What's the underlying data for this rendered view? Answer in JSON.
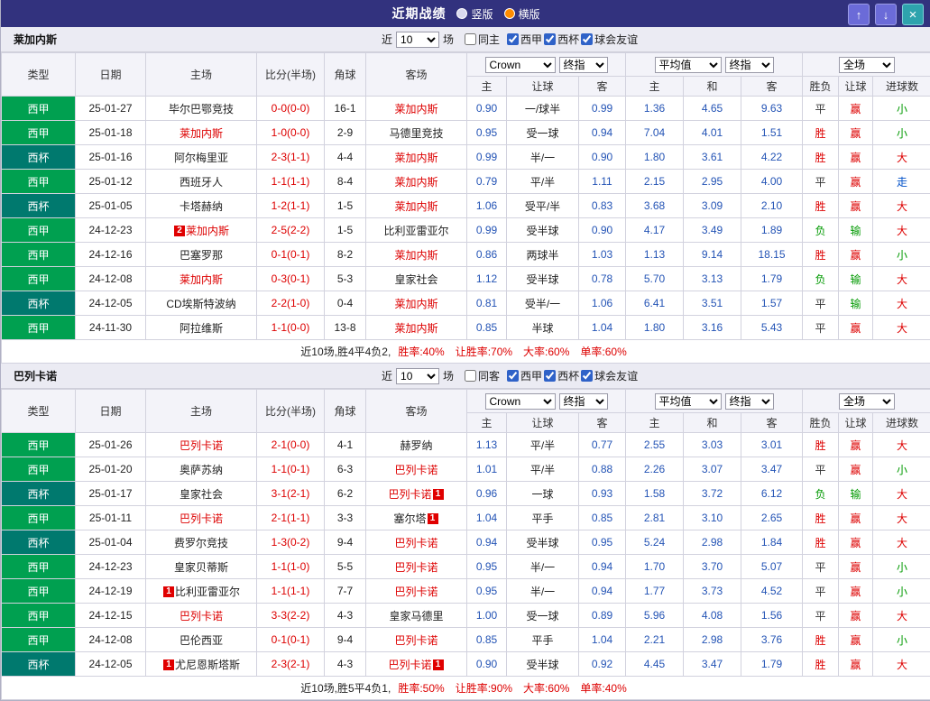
{
  "topbar": {
    "title": "近期战绩",
    "radios": {
      "vertical": "竖版",
      "horizontal": "横版",
      "selected": "横版"
    },
    "buttons": {
      "up": "↑",
      "down": "↓",
      "close": "×"
    }
  },
  "dropdowns": {
    "bookmaker": "Crown",
    "ah_stage": "终指",
    "eu_average": "平均值",
    "eu_stage": "终指",
    "scope": "全场"
  },
  "header_labels": {
    "type": "类型",
    "date": "日期",
    "home": "主场",
    "score": "比分(半场)",
    "corner": "角球",
    "away": "客场",
    "ah_home": "主",
    "ah_line": "让球",
    "ah_away": "客",
    "eu_home": "主",
    "eu_draw": "和",
    "eu_away": "客",
    "result": "胜负",
    "ah_result": "让球",
    "goals": "进球数"
  },
  "colors": {
    "topbar_bg": "#32327E",
    "radio_selected": "#FF8C00",
    "button_blue": "#6B6BD8",
    "button_teal": "#2EA3AD",
    "text": "#222222",
    "odds": "#2353B5",
    "score": "#DD0000",
    "focus_team": "#DD0000",
    "league": {
      "西甲": "#00A050",
      "西杯": "#00796E"
    },
    "result": {
      "胜": "#DD0000",
      "平": "#333333",
      "负": "#009900",
      "赢": "#DD0000",
      "输": "#009900",
      "走": "#0050C8",
      "大": "#DD0000",
      "小": "#009900"
    }
  },
  "sections": [
    {
      "team": "莱加内斯",
      "filters": {
        "near": "近",
        "count": "10",
        "games": "场",
        "same": "同主",
        "same_checked": false,
        "leagues": [
          {
            "label": "西甲",
            "checked": true
          },
          {
            "label": "西杯",
            "checked": true
          },
          {
            "label": "球会友谊",
            "checked": true
          }
        ]
      },
      "rows": [
        {
          "league": "西甲",
          "date": "25-01-27",
          "home": {
            "name": "毕尔巴鄂竞技"
          },
          "score": "0-0(0-0)",
          "corners": "16-1",
          "away": {
            "name": "莱加内斯",
            "focus": true
          },
          "ah": [
            "0.90",
            "一/球半",
            "0.99"
          ],
          "eu": [
            "1.36",
            "4.65",
            "9.63"
          ],
          "res": [
            "平",
            "赢",
            "小"
          ]
        },
        {
          "league": "西甲",
          "date": "25-01-18",
          "home": {
            "name": "莱加内斯",
            "focus": true
          },
          "score": "1-0(0-0)",
          "corners": "2-9",
          "away": {
            "name": "马德里竞技"
          },
          "ah": [
            "0.95",
            "受一球",
            "0.94"
          ],
          "eu": [
            "7.04",
            "4.01",
            "1.51"
          ],
          "res": [
            "胜",
            "赢",
            "小"
          ]
        },
        {
          "league": "西杯",
          "date": "25-01-16",
          "home": {
            "name": "阿尔梅里亚"
          },
          "score": "2-3(1-1)",
          "corners": "4-4",
          "away": {
            "name": "莱加内斯",
            "focus": true
          },
          "ah": [
            "0.99",
            "半/一",
            "0.90"
          ],
          "eu": [
            "1.80",
            "3.61",
            "4.22"
          ],
          "res": [
            "胜",
            "赢",
            "大"
          ]
        },
        {
          "league": "西甲",
          "date": "25-01-12",
          "home": {
            "name": "西班牙人"
          },
          "score": "1-1(1-1)",
          "corners": "8-4",
          "away": {
            "name": "莱加内斯",
            "focus": true
          },
          "ah": [
            "0.79",
            "平/半",
            "1.11"
          ],
          "eu": [
            "2.15",
            "2.95",
            "4.00"
          ],
          "res": [
            "平",
            "赢",
            "走"
          ]
        },
        {
          "league": "西杯",
          "date": "25-01-05",
          "home": {
            "name": "卡塔赫纳"
          },
          "score": "1-2(1-1)",
          "corners": "1-5",
          "away": {
            "name": "莱加内斯",
            "focus": true
          },
          "ah": [
            "1.06",
            "受平/半",
            "0.83"
          ],
          "eu": [
            "3.68",
            "3.09",
            "2.10"
          ],
          "res": [
            "胜",
            "赢",
            "大"
          ]
        },
        {
          "league": "西甲",
          "date": "24-12-23",
          "home": {
            "name": "莱加内斯",
            "focus": true,
            "badge": "2",
            "badge_pos": "before"
          },
          "score": "2-5(2-2)",
          "corners": "1-5",
          "away": {
            "name": "比利亚雷亚尔"
          },
          "ah": [
            "0.99",
            "受半球",
            "0.90"
          ],
          "eu": [
            "4.17",
            "3.49",
            "1.89"
          ],
          "res": [
            "负",
            "输",
            "大"
          ]
        },
        {
          "league": "西甲",
          "date": "24-12-16",
          "home": {
            "name": "巴塞罗那"
          },
          "score": "0-1(0-1)",
          "corners": "8-2",
          "away": {
            "name": "莱加内斯",
            "focus": true
          },
          "ah": [
            "0.86",
            "两球半",
            "1.03"
          ],
          "eu": [
            "1.13",
            "9.14",
            "18.15"
          ],
          "res": [
            "胜",
            "赢",
            "小"
          ]
        },
        {
          "league": "西甲",
          "date": "24-12-08",
          "home": {
            "name": "莱加内斯",
            "focus": true
          },
          "score": "0-3(0-1)",
          "corners": "5-3",
          "away": {
            "name": "皇家社会"
          },
          "ah": [
            "1.12",
            "受半球",
            "0.78"
          ],
          "eu": [
            "5.70",
            "3.13",
            "1.79"
          ],
          "res": [
            "负",
            "输",
            "大"
          ]
        },
        {
          "league": "西杯",
          "date": "24-12-05",
          "home": {
            "name": "CD埃斯特波纳"
          },
          "score": "2-2(1-0)",
          "corners": "0-4",
          "away": {
            "name": "莱加内斯",
            "focus": true
          },
          "ah": [
            "0.81",
            "受半/一",
            "1.06"
          ],
          "eu": [
            "6.41",
            "3.51",
            "1.57"
          ],
          "res": [
            "平",
            "输",
            "大"
          ]
        },
        {
          "league": "西甲",
          "date": "24-11-30",
          "home": {
            "name": "阿拉维斯"
          },
          "score": "1-1(0-0)",
          "corners": "13-8",
          "away": {
            "name": "莱加内斯",
            "focus": true
          },
          "ah": [
            "0.85",
            "半球",
            "1.04"
          ],
          "eu": [
            "1.80",
            "3.16",
            "5.43"
          ],
          "res": [
            "平",
            "赢",
            "大"
          ]
        }
      ],
      "summary": {
        "record": "近10场,胜4平4负2,",
        "rates": [
          "胜率:40%",
          "让胜率:70%",
          "大率:60%",
          "单率:60%"
        ]
      }
    },
    {
      "team": "巴列卡诺",
      "filters": {
        "near": "近",
        "count": "10",
        "games": "场",
        "same": "同客",
        "same_checked": false,
        "leagues": [
          {
            "label": "西甲",
            "checked": true
          },
          {
            "label": "西杯",
            "checked": true
          },
          {
            "label": "球会友谊",
            "checked": true
          }
        ]
      },
      "rows": [
        {
          "league": "西甲",
          "date": "25-01-26",
          "home": {
            "name": "巴列卡诺",
            "focus": true
          },
          "score": "2-1(0-0)",
          "corners": "4-1",
          "away": {
            "name": "赫罗纳"
          },
          "ah": [
            "1.13",
            "平/半",
            "0.77"
          ],
          "eu": [
            "2.55",
            "3.03",
            "3.01"
          ],
          "res": [
            "胜",
            "赢",
            "大"
          ]
        },
        {
          "league": "西甲",
          "date": "25-01-20",
          "home": {
            "name": "奥萨苏纳"
          },
          "score": "1-1(0-1)",
          "corners": "6-3",
          "away": {
            "name": "巴列卡诺",
            "focus": true
          },
          "ah": [
            "1.01",
            "平/半",
            "0.88"
          ],
          "eu": [
            "2.26",
            "3.07",
            "3.47"
          ],
          "res": [
            "平",
            "赢",
            "小"
          ]
        },
        {
          "league": "西杯",
          "date": "25-01-17",
          "home": {
            "name": "皇家社会"
          },
          "score": "3-1(2-1)",
          "corners": "6-2",
          "away": {
            "name": "巴列卡诺",
            "focus": true,
            "badge": "1",
            "badge_pos": "after"
          },
          "ah": [
            "0.96",
            "一球",
            "0.93"
          ],
          "eu": [
            "1.58",
            "3.72",
            "6.12"
          ],
          "res": [
            "负",
            "输",
            "大"
          ]
        },
        {
          "league": "西甲",
          "date": "25-01-11",
          "home": {
            "name": "巴列卡诺",
            "focus": true
          },
          "score": "2-1(1-1)",
          "corners": "3-3",
          "away": {
            "name": "塞尔塔",
            "badge": "1",
            "badge_pos": "after"
          },
          "ah": [
            "1.04",
            "平手",
            "0.85"
          ],
          "eu": [
            "2.81",
            "3.10",
            "2.65"
          ],
          "res": [
            "胜",
            "赢",
            "大"
          ]
        },
        {
          "league": "西杯",
          "date": "25-01-04",
          "home": {
            "name": "费罗尔竞技"
          },
          "score": "1-3(0-2)",
          "corners": "9-4",
          "away": {
            "name": "巴列卡诺",
            "focus": true
          },
          "ah": [
            "0.94",
            "受半球",
            "0.95"
          ],
          "eu": [
            "5.24",
            "2.98",
            "1.84"
          ],
          "res": [
            "胜",
            "赢",
            "大"
          ]
        },
        {
          "league": "西甲",
          "date": "24-12-23",
          "home": {
            "name": "皇家贝蒂斯"
          },
          "score": "1-1(1-0)",
          "corners": "5-5",
          "away": {
            "name": "巴列卡诺",
            "focus": true
          },
          "ah": [
            "0.95",
            "半/一",
            "0.94"
          ],
          "eu": [
            "1.70",
            "3.70",
            "5.07"
          ],
          "res": [
            "平",
            "赢",
            "小"
          ]
        },
        {
          "league": "西甲",
          "date": "24-12-19",
          "home": {
            "name": "比利亚雷亚尔",
            "badge": "1",
            "badge_pos": "before"
          },
          "score": "1-1(1-1)",
          "corners": "7-7",
          "away": {
            "name": "巴列卡诺",
            "focus": true
          },
          "ah": [
            "0.95",
            "半/一",
            "0.94"
          ],
          "eu": [
            "1.77",
            "3.73",
            "4.52"
          ],
          "res": [
            "平",
            "赢",
            "小"
          ]
        },
        {
          "league": "西甲",
          "date": "24-12-15",
          "home": {
            "name": "巴列卡诺",
            "focus": true
          },
          "score": "3-3(2-2)",
          "corners": "4-3",
          "away": {
            "name": "皇家马德里"
          },
          "ah": [
            "1.00",
            "受一球",
            "0.89"
          ],
          "eu": [
            "5.96",
            "4.08",
            "1.56"
          ],
          "res": [
            "平",
            "赢",
            "大"
          ]
        },
        {
          "league": "西甲",
          "date": "24-12-08",
          "home": {
            "name": "巴伦西亚"
          },
          "score": "0-1(0-1)",
          "corners": "9-4",
          "away": {
            "name": "巴列卡诺",
            "focus": true
          },
          "ah": [
            "0.85",
            "平手",
            "1.04"
          ],
          "eu": [
            "2.21",
            "2.98",
            "3.76"
          ],
          "res": [
            "胜",
            "赢",
            "小"
          ]
        },
        {
          "league": "西杯",
          "date": "24-12-05",
          "home": {
            "name": "尤尼恩斯塔斯",
            "badge": "1",
            "badge_pos": "before"
          },
          "score": "2-3(2-1)",
          "corners": "4-3",
          "away": {
            "name": "巴列卡诺",
            "focus": true,
            "badge": "1",
            "badge_pos": "after"
          },
          "ah": [
            "0.90",
            "受半球",
            "0.92"
          ],
          "eu": [
            "4.45",
            "3.47",
            "1.79"
          ],
          "res": [
            "胜",
            "赢",
            "大"
          ]
        }
      ],
      "summary": {
        "record": "近10场,胜5平4负1,",
        "rates": [
          "胜率:50%",
          "让胜率:90%",
          "大率:60%",
          "单率:40%"
        ]
      }
    }
  ]
}
